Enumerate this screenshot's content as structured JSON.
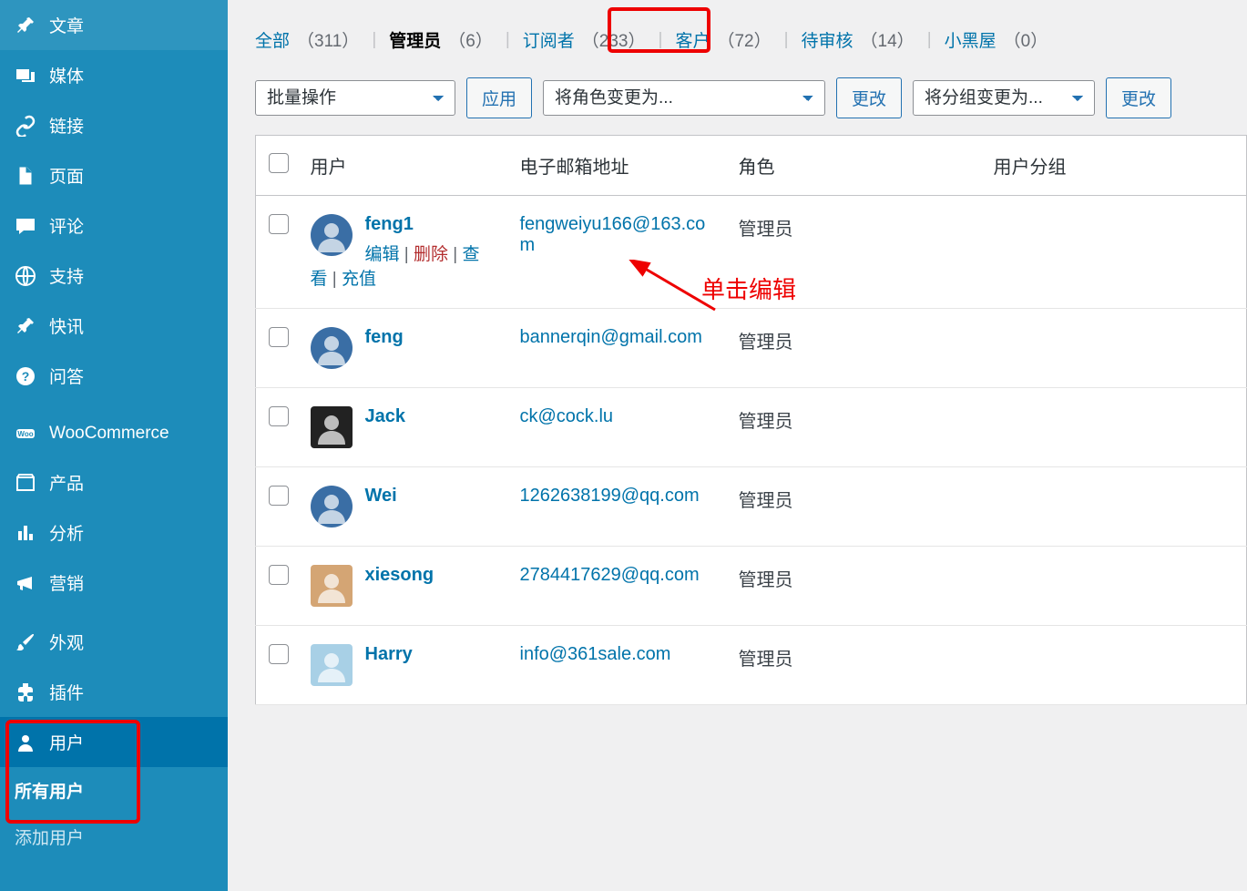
{
  "sidebar": {
    "items": [
      {
        "icon": "pin",
        "label": "文章"
      },
      {
        "icon": "media",
        "label": "媒体"
      },
      {
        "icon": "link",
        "label": "链接"
      },
      {
        "icon": "page",
        "label": "页面"
      },
      {
        "icon": "comment",
        "label": "评论"
      },
      {
        "icon": "globe",
        "label": "支持"
      },
      {
        "icon": "pin",
        "label": "快讯"
      },
      {
        "icon": "help",
        "label": "问答"
      },
      {
        "icon": "woo",
        "label": "WooCommerce"
      },
      {
        "icon": "product",
        "label": "产品"
      },
      {
        "icon": "analytics",
        "label": "分析"
      },
      {
        "icon": "megaphone",
        "label": "营销"
      },
      {
        "icon": "brush",
        "label": "外观"
      },
      {
        "icon": "plugin",
        "label": "插件"
      },
      {
        "icon": "user",
        "label": "用户"
      }
    ],
    "submenu": [
      {
        "label": "所有用户",
        "current": true
      },
      {
        "label": "添加用户",
        "current": false
      }
    ]
  },
  "tabs": [
    {
      "label": "全部",
      "count": "（311）",
      "current": false
    },
    {
      "label": "管理员",
      "count": "（6）",
      "current": true
    },
    {
      "label": "订阅者",
      "count": "（233）",
      "current": false
    },
    {
      "label": "客户",
      "count": "（72）",
      "current": false
    },
    {
      "label": "待审核",
      "count": "（14）",
      "current": false
    },
    {
      "label": "小黑屋",
      "count": "（0）",
      "current": false
    }
  ],
  "toolbar": {
    "bulk": "批量操作",
    "apply": "应用",
    "role": "将角色变更为...",
    "change": "更改",
    "group": "将分组变更为...",
    "change2": "更改"
  },
  "columns": {
    "user": "用户",
    "email": "电子邮箱地址",
    "role": "角色",
    "group": "用户分组"
  },
  "rowactions": {
    "edit": "编辑",
    "delete": "删除",
    "viewA": "查",
    "viewB": "看",
    "recharge": "充值"
  },
  "rows": [
    {
      "name": "feng1",
      "email": "fengweiyu166@163.com",
      "role": "管理员",
      "show_actions": true,
      "av": "round",
      "avcolor": "#3a6ea5"
    },
    {
      "name": "feng",
      "email": "bannerqin@gmail.com",
      "role": "管理员",
      "show_actions": false,
      "av": "round",
      "avcolor": "#3a6ea5"
    },
    {
      "name": "Jack",
      "email": "ck@cock.lu",
      "role": "管理员",
      "show_actions": false,
      "av": "square",
      "avcolor": "#222"
    },
    {
      "name": "Wei",
      "email": "1262638199@qq.com",
      "role": "管理员",
      "show_actions": false,
      "av": "round",
      "avcolor": "#3a6ea5"
    },
    {
      "name": "xiesong",
      "email": "2784417629@qq.com",
      "role": "管理员",
      "show_actions": false,
      "av": "square",
      "avcolor": "#d4a574"
    },
    {
      "name": "Harry",
      "email": "info@361sale.com",
      "role": "管理员",
      "show_actions": false,
      "av": "square",
      "avcolor": "#a8d0e6"
    }
  ],
  "annotation": "单击编辑"
}
